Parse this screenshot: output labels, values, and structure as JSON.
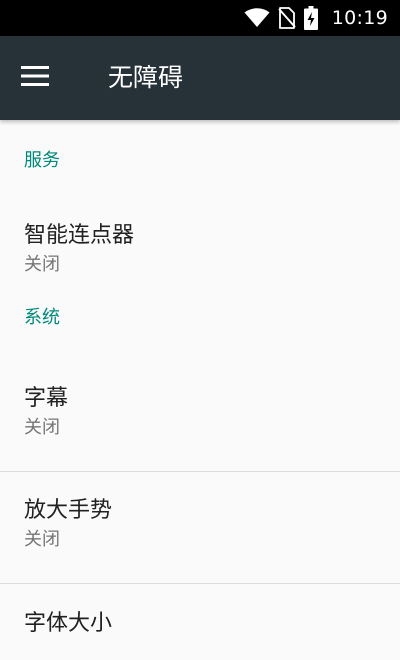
{
  "status_bar": {
    "time": "10:19",
    "icons": [
      "wifi-icon",
      "no-sim-icon",
      "battery-charging-icon"
    ]
  },
  "app_bar": {
    "title": "无障碍",
    "menu_icon": "menu-icon"
  },
  "sections": [
    {
      "header": "服务",
      "items": [
        {
          "title": "智能连点器",
          "summary": "关闭"
        }
      ]
    },
    {
      "header": "系统",
      "items": [
        {
          "title": "字幕",
          "summary": "关闭"
        },
        {
          "title": "放大手势",
          "summary": "关闭"
        },
        {
          "title": "字体大小",
          "summary": ""
        }
      ]
    }
  ],
  "colors": {
    "app_bar": "#263238",
    "accent": "#00897b",
    "background": "#fafafa"
  }
}
